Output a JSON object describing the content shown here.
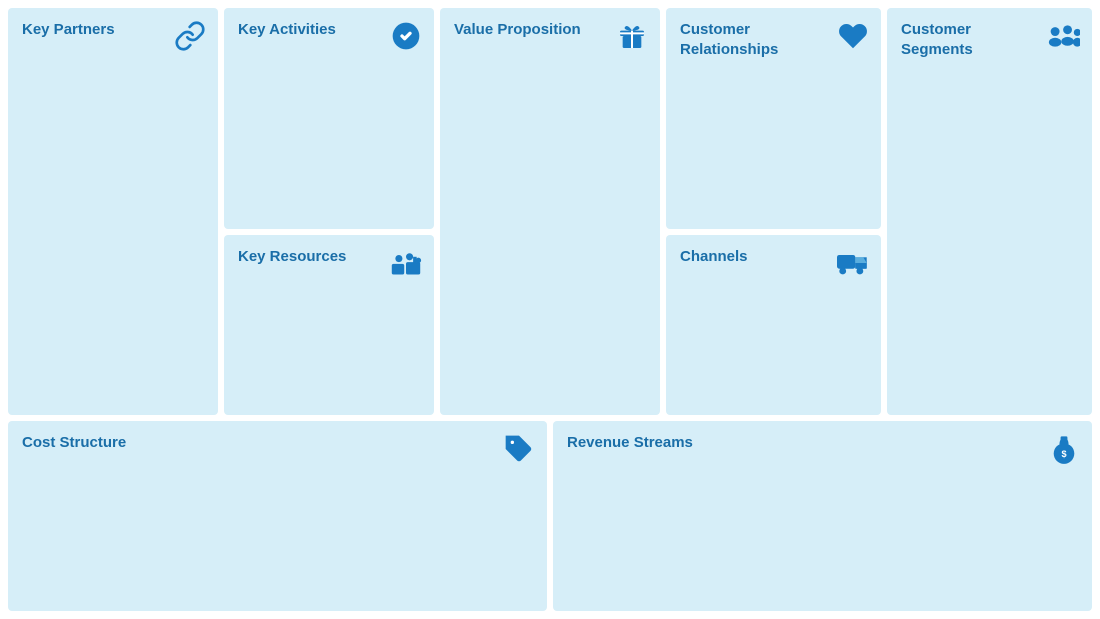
{
  "cells": {
    "key_partners": {
      "title": "Key Partners",
      "icon": "link-icon"
    },
    "key_activities": {
      "title": "Key Activities",
      "icon": "check-icon"
    },
    "key_resources": {
      "title": "Key Resources",
      "icon": "factory-icon"
    },
    "value_proposition": {
      "title": "Value Proposition",
      "icon": "gift-icon"
    },
    "customer_relationships": {
      "title": "Customer Relationships",
      "icon": "heart-icon"
    },
    "channels": {
      "title": "Channels",
      "icon": "truck-icon"
    },
    "customer_segments": {
      "title": "Customer Segments",
      "icon": "people-icon"
    },
    "cost_structure": {
      "title": "Cost Structure",
      "icon": "tag-icon"
    },
    "revenue_streams": {
      "title": "Revenue Streams",
      "icon": "moneybag-icon"
    }
  },
  "colors": {
    "cell_bg": "#d6eef8",
    "text": "#1a6ea8",
    "icon": "#1a7bc4"
  }
}
